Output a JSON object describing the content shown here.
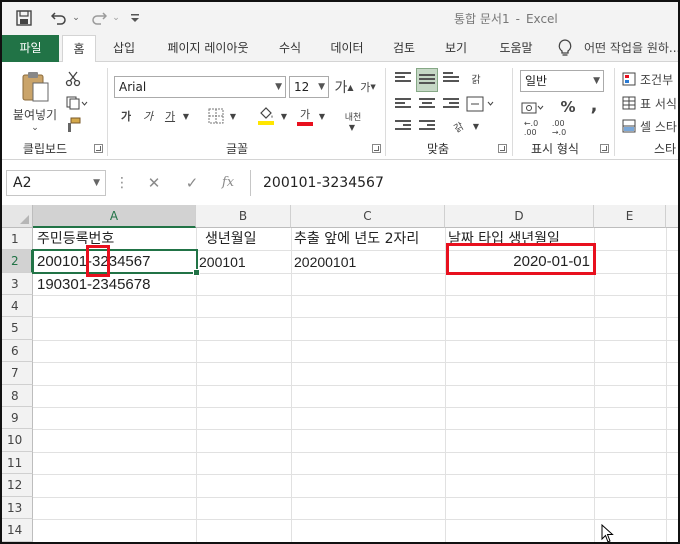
{
  "app": {
    "doc_name": "통합 문서1",
    "separator": "-",
    "app_name": "Excel"
  },
  "quick_access": {
    "icons": [
      "save-icon",
      "undo-icon",
      "redo-icon",
      "customize-icon"
    ]
  },
  "tabs": [
    {
      "label": "파일"
    },
    {
      "label": "홈"
    },
    {
      "label": "삽입"
    },
    {
      "label": "페이지 레이아웃"
    },
    {
      "label": "수식"
    },
    {
      "label": "데이터"
    },
    {
      "label": "검토"
    },
    {
      "label": "보기"
    },
    {
      "label": "도움말"
    }
  ],
  "tell_me": "어떤 작업을 원하...",
  "ribbon": {
    "clipboard": {
      "paste_label": "붙여넣기",
      "group_label": "클립보드"
    },
    "font": {
      "family": "Arial",
      "size": "12",
      "grow": "가",
      "shrink": "가",
      "bold": "가",
      "italic": "가",
      "underline": "가",
      "font_color_glyph": "가",
      "phonetic_glyph": "내천",
      "group_label": "글꼴",
      "fill_color": "#ffe600",
      "font_color": "#e8101e"
    },
    "alignment": {
      "wrap_glyph": "갉",
      "orientation_glyph": "갉",
      "group_label": "맞춤"
    },
    "number": {
      "format": "일반",
      "percent": "%",
      "comma": ",",
      "inc_decimal": "←.0\n.00",
      "dec_decimal": ".00\n→.0",
      "group_label": "표시 형식"
    },
    "styles": {
      "conditional": "조건부",
      "table": "표 서식",
      "cell": "셀 스타",
      "group_label": "스타"
    }
  },
  "formula_bar": {
    "name_box": "A2",
    "formula": "200101-3234567"
  },
  "sheet": {
    "columns": [
      "A",
      "B",
      "C",
      "D",
      "E"
    ],
    "rows": [
      "1",
      "2",
      "3",
      "4",
      "5",
      "6",
      "7",
      "8",
      "9",
      "10",
      "11",
      "12",
      "13",
      "14"
    ],
    "cells": {
      "A1": "주민등록번호",
      "B1": "생년월일",
      "C1": "추출 앞에 년도 2자리",
      "D1": "날짜 타입 생년월일",
      "A2": "200101-3234567",
      "B2": "200101",
      "C2": "20200101",
      "D2": "2020-01-01",
      "A3": "190301-2345678"
    },
    "active_cell": "A2"
  },
  "colors": {
    "brand": "#217346",
    "highlight": "#e8101e"
  }
}
